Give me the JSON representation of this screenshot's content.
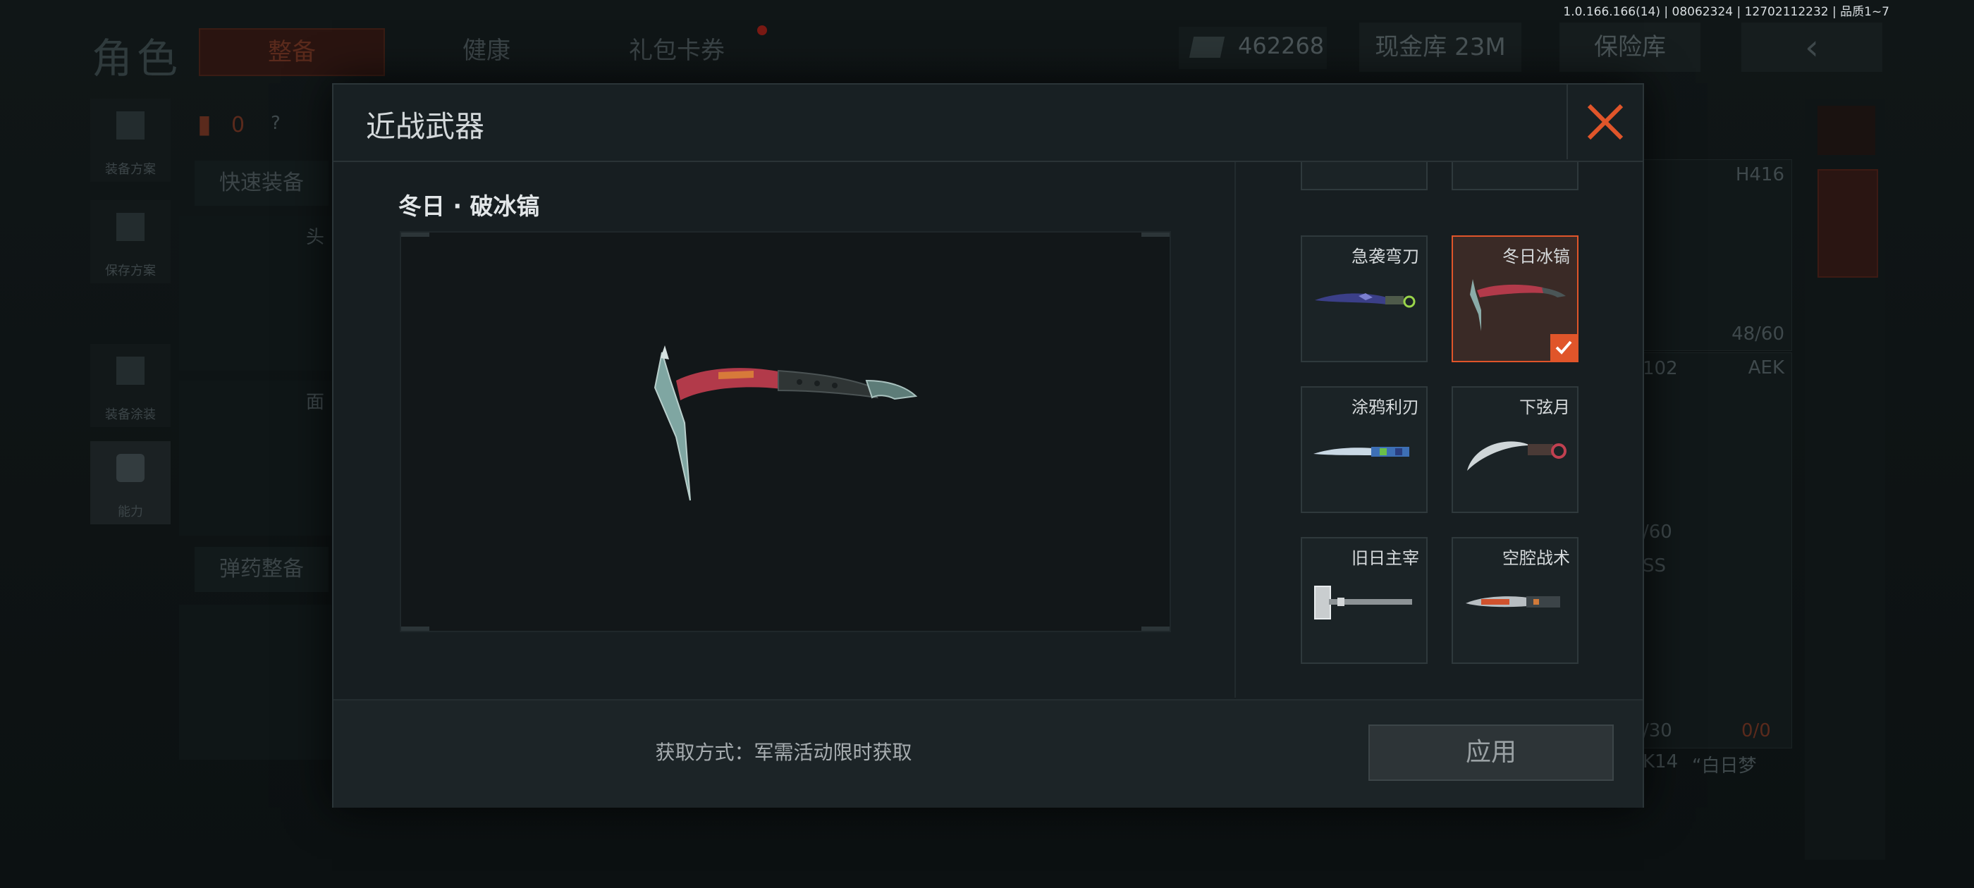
{
  "build_info": "1.0.166.166(14) | 08062324 | 12702112232 | 品质1~7",
  "background": {
    "page_title": "角色",
    "tabs": [
      "整备",
      "健康",
      "礼包卡券"
    ],
    "currency_value": "462268",
    "cash_vault_label": "现金库 23M",
    "safe_vault_label": "保险库",
    "back_icon": "‹",
    "side_buttons": [
      "装备方案",
      "保存方案",
      "装备涂装",
      "能力"
    ],
    "quick_equip_label": "快速装备",
    "ammo_label": "弹药整备",
    "armor_count": "0",
    "help_mark": "?",
    "slot_labels": [
      "头",
      "面"
    ],
    "weapon1": {
      "name": "H416",
      "ammo": "48/60"
    },
    "weapon2": {
      "name": "AEK",
      "ammo_partial": "/60",
      "partial_name": "SS",
      "partial_code": "102"
    },
    "misc_labels": [
      "/30",
      "0/0",
      "K14",
      "“白日梦"
    ]
  },
  "modal": {
    "title": "近战武器",
    "selected_item_name": "冬日 · 破冰镐",
    "items": [
      {
        "label": "急袭弯刀",
        "selected": false,
        "icon": "karambit-blade-icon"
      },
      {
        "label": "冬日冰镐",
        "selected": true,
        "icon": "ice-pick-icon"
      },
      {
        "label": "涂鸦利刃",
        "selected": false,
        "icon": "graffiti-knife-icon"
      },
      {
        "label": "下弦月",
        "selected": false,
        "icon": "crescent-karambit-icon"
      },
      {
        "label": "旧日主宰",
        "selected": false,
        "icon": "sledgehammer-icon"
      },
      {
        "label": "空腔战术",
        "selected": false,
        "icon": "tactical-knife-icon"
      }
    ],
    "acquire_text": "获取方式：军需活动限时获取",
    "apply_label": "应用",
    "close_icon": "close-icon"
  },
  "colors": {
    "accent": "#e0552a",
    "modal_bg": "#171e21",
    "panel_border": "#2f393c"
  }
}
